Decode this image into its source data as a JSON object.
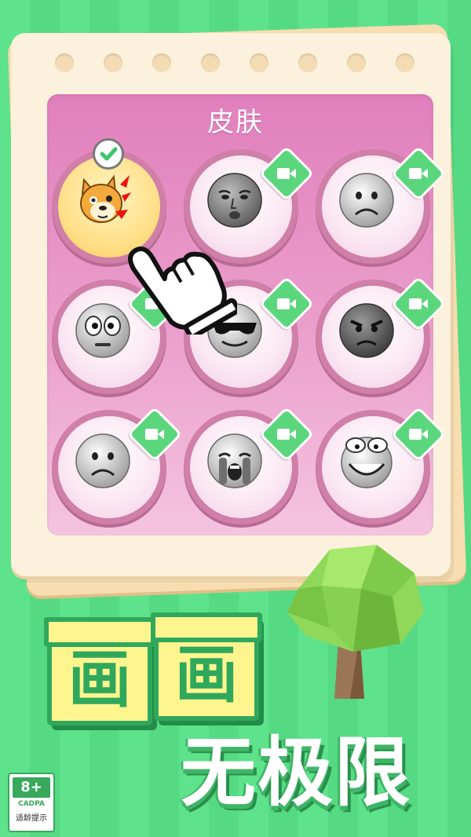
{
  "panel": {
    "title": "皮肤"
  },
  "skins": [
    {
      "id": "doge",
      "face": "doge-face-icon",
      "selected": true,
      "locked": false
    },
    {
      "id": "realistic",
      "face": "realistic-face-icon",
      "selected": false,
      "locked": true
    },
    {
      "id": "sad",
      "face": "sad-face-icon",
      "selected": false,
      "locked": true
    },
    {
      "id": "staring",
      "face": "staring-face-icon",
      "selected": false,
      "locked": true
    },
    {
      "id": "sunglasses",
      "face": "sunglasses-face-icon",
      "selected": false,
      "locked": true
    },
    {
      "id": "angry",
      "face": "angry-face-icon",
      "selected": false,
      "locked": true
    },
    {
      "id": "frown",
      "face": "frown-face-icon",
      "selected": false,
      "locked": true
    },
    {
      "id": "crying",
      "face": "crying-face-icon",
      "selected": false,
      "locked": true
    },
    {
      "id": "smug",
      "face": "smug-face-icon",
      "selected": false,
      "locked": true
    }
  ],
  "title_chars": [
    "画",
    "画"
  ],
  "slogan": "无极限",
  "age_rating": {
    "age": "8+",
    "org": "CADPA",
    "note": "适龄提示"
  },
  "colors": {
    "background": "#5fe28c",
    "panel": "#e17fbd",
    "badge": "#5bd67d",
    "title_text": "#2fa85c"
  }
}
